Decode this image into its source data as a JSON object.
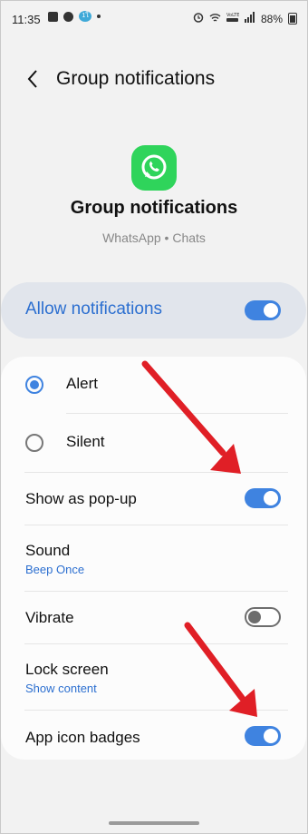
{
  "status_bar": {
    "time": "11:35",
    "notif_badge": "1ใ",
    "battery": "88%"
  },
  "header": {
    "title": "Group notifications"
  },
  "app": {
    "name": "Group notifications",
    "subtitle": "WhatsApp • Chats"
  },
  "allow": {
    "label": "Allow notifications",
    "enabled": true
  },
  "alert_options": [
    {
      "label": "Alert",
      "selected": true
    },
    {
      "label": "Silent",
      "selected": false
    }
  ],
  "settings": {
    "popup_label": "Show as pop-up",
    "popup_on": true,
    "sound_label": "Sound",
    "sound_value": "Beep Once",
    "vibrate_label": "Vibrate",
    "vibrate_on": false,
    "lockscreen_label": "Lock screen",
    "lockscreen_value": "Show content",
    "badges_label": "App icon badges",
    "badges_on": true
  },
  "colors": {
    "accent": "#3f83e0",
    "whatsapp_green": "#2fd45b",
    "arrow_red": "#e01f26"
  }
}
